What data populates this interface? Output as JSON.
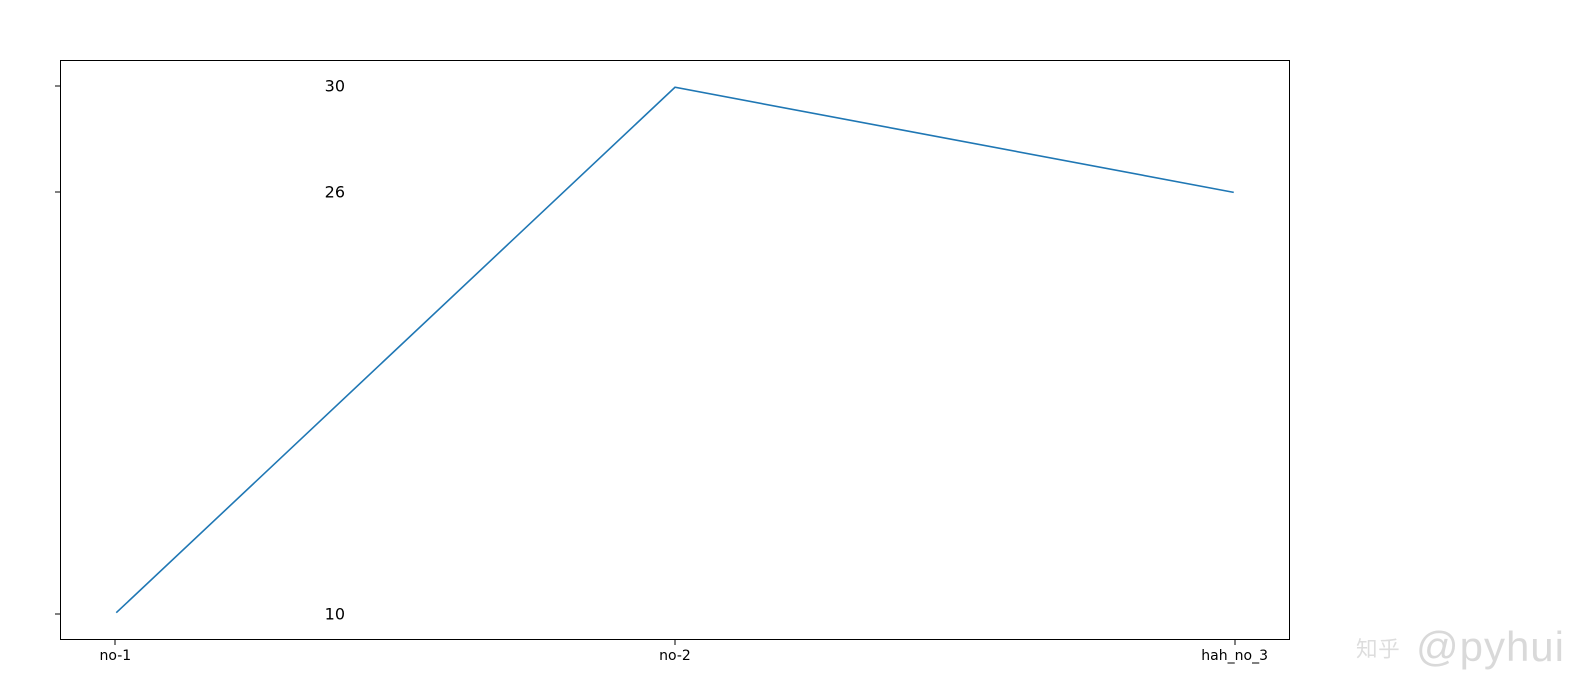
{
  "chart_data": {
    "type": "line",
    "categories": [
      "no-1",
      "no-2",
      "hah_no_3"
    ],
    "values": [
      10,
      30,
      26
    ],
    "y_ticks": [
      10,
      26,
      30
    ],
    "title": "",
    "xlabel": "",
    "ylabel": "",
    "ylim": [
      9,
      31
    ],
    "line_color": "#1f77b4"
  },
  "watermark": {
    "text": "@pyhui",
    "brand": "知乎"
  }
}
